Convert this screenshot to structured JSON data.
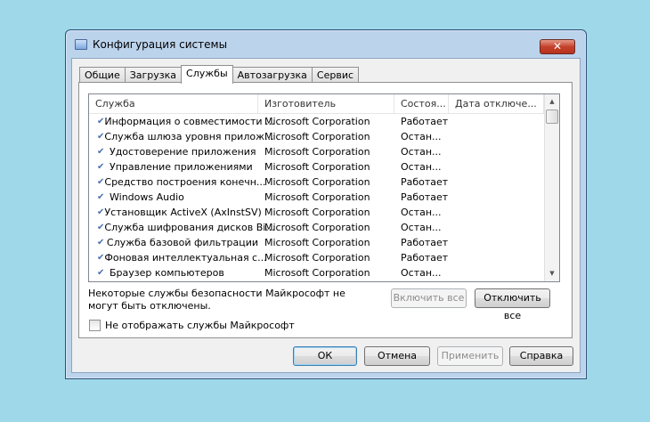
{
  "window": {
    "title": "Конфигурация системы",
    "close": "✕"
  },
  "tabs": [
    "Общие",
    "Загрузка",
    "Службы",
    "Автозагрузка",
    "Сервис"
  ],
  "active_tab": "Службы",
  "columns": [
    "Служба",
    "Изготовитель",
    "Состоя...",
    "Дата отключе..."
  ],
  "rows": [
    {
      "name": "Информация о совместимости ...",
      "maker": "Microsoft Corporation",
      "state": "Работает"
    },
    {
      "name": "Служба шлюза уровня прилож...",
      "maker": "Microsoft Corporation",
      "state": "Остан..."
    },
    {
      "name": "Удостоверение приложения",
      "maker": "Microsoft Corporation",
      "state": "Остан..."
    },
    {
      "name": "Управление приложениями",
      "maker": "Microsoft Corporation",
      "state": "Остан..."
    },
    {
      "name": "Средство построения конечн...",
      "maker": "Microsoft Corporation",
      "state": "Работает"
    },
    {
      "name": "Windows Audio",
      "maker": "Microsoft Corporation",
      "state": "Работает"
    },
    {
      "name": "Установщик ActiveX (AxInstSV)",
      "maker": "Microsoft Corporation",
      "state": "Остан..."
    },
    {
      "name": "Служба шифрования дисков Bi...",
      "maker": "Microsoft Corporation",
      "state": "Остан..."
    },
    {
      "name": "Служба базовой фильтрации",
      "maker": "Microsoft Corporation",
      "state": "Работает"
    },
    {
      "name": "Фоновая интеллектуальная с...",
      "maker": "Microsoft Corporation",
      "state": "Работает"
    },
    {
      "name": "Браузер компьютеров",
      "maker": "Microsoft Corporation",
      "state": "Остан..."
    }
  ],
  "message": "Некоторые службы безопасности Майкрософт не могут быть отключены.",
  "enable_all": "Включить все",
  "disable_all": "Отключить все",
  "hide_ms": "Не отображать службы Майкрософт",
  "buttons": {
    "ok": "ОК",
    "cancel": "Отмена",
    "apply": "Применить",
    "help": "Справка"
  }
}
